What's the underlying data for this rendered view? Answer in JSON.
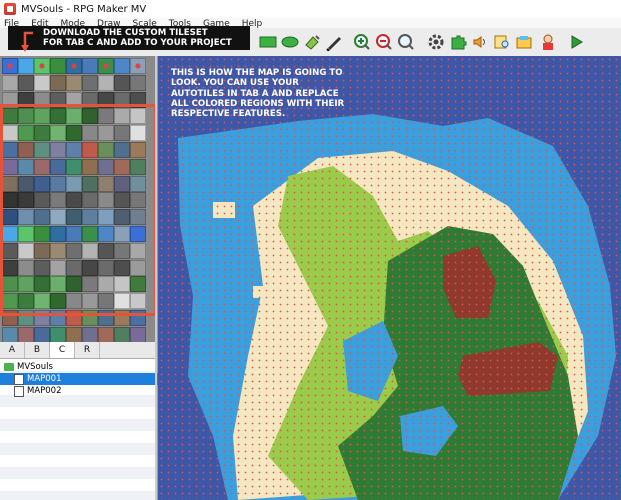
{
  "window": {
    "title": "MVSouls - RPG Maker MV"
  },
  "menu": {
    "items": [
      "File",
      "Edit",
      "Mode",
      "Draw",
      "Scale",
      "Tools",
      "Game",
      "Help"
    ]
  },
  "callout": {
    "line1": "DOWNLOAD THE CUSTOM TILESET",
    "line2": "FOR TAB C AND ADD TO YOUR PROJECT"
  },
  "map_note": {
    "text": "THIS IS HOW THE MAP IS GOING TO LOOK. YOU CAN USE YOUR AUTOTILES IN TAB A AND REPLACE ALL COLORED REGIONS WITH THEIR RESPECTIVE FEATURES."
  },
  "tabs": [
    "A",
    "B",
    "C",
    "R"
  ],
  "active_tab": "C",
  "tree": {
    "project": "MVSouls",
    "maps": [
      {
        "name": "MAP001",
        "selected": true
      },
      {
        "name": "MAP002",
        "selected": false
      }
    ]
  },
  "toolbar": {
    "icons": [
      "rectangle-tool-icon",
      "ellipse-tool-icon",
      "fill-tool-icon",
      "shadow-pen-icon",
      "zoom-in-icon",
      "zoom-out-icon",
      "actual-size-icon",
      "database-icon",
      "plugin-manager-icon",
      "sound-test-icon",
      "event-searcher-icon",
      "resource-manager-icon",
      "character-generator-icon",
      "playtest-icon"
    ]
  },
  "colors": {
    "deep_water": "#3f57a7",
    "shallow_water": "#3b9fdd",
    "sand": "#f5e8c1",
    "grass": "#9acb4a",
    "forest": "#2f7b33",
    "mountain": "#8f3a2c",
    "region_dot": "#e05252",
    "highlight": "#e4543b"
  }
}
